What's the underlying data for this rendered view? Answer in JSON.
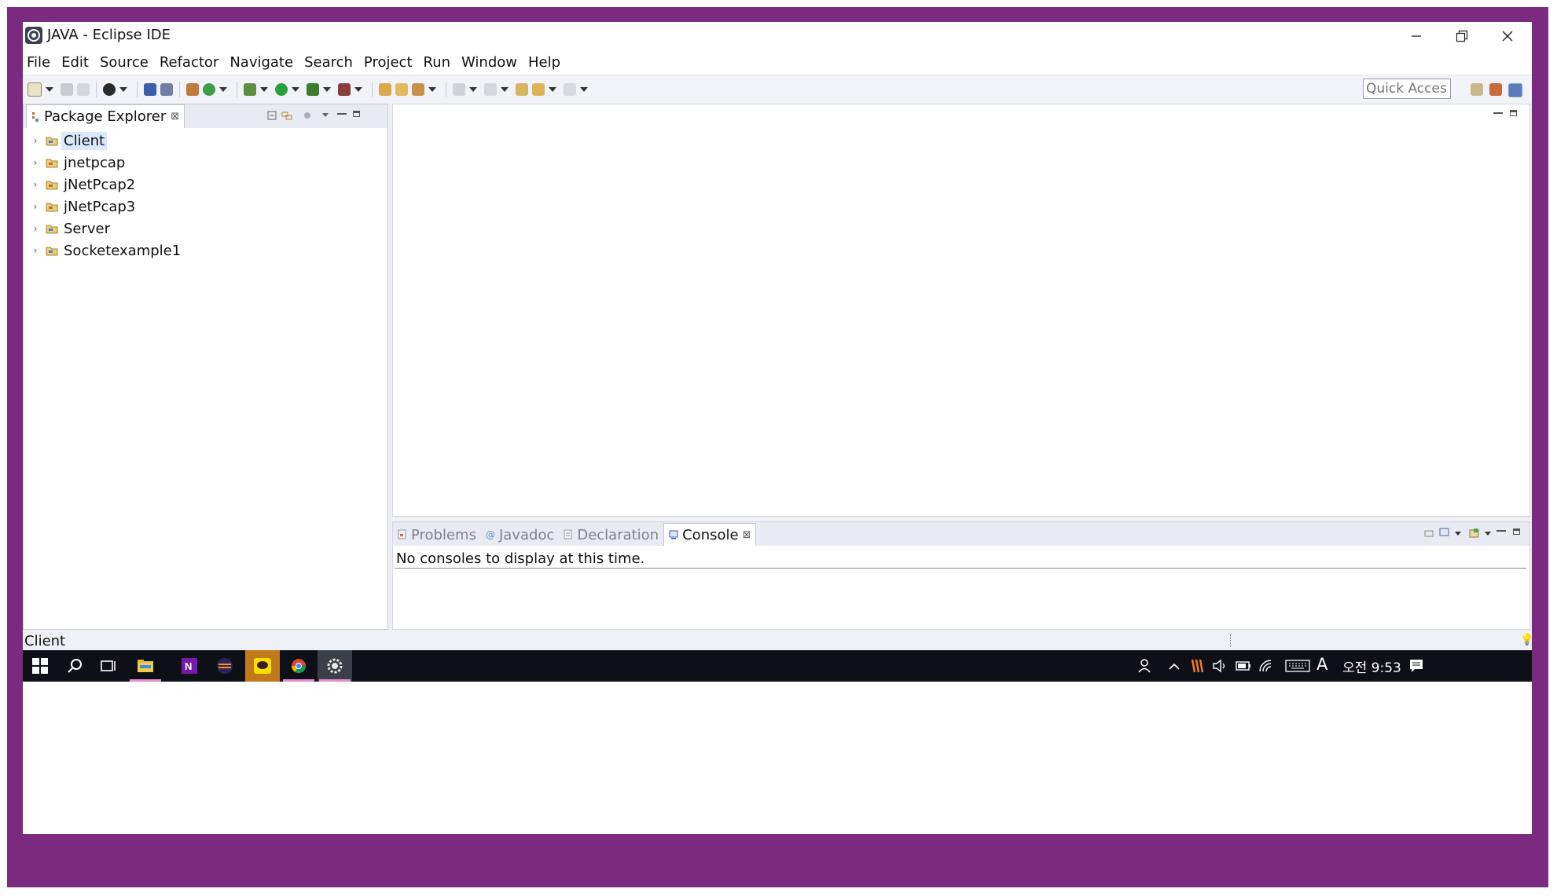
{
  "window": {
    "title": "JAVA - Eclipse IDE",
    "controls": {
      "minimize": "─",
      "restore": "❐",
      "close": "✕"
    }
  },
  "menu": [
    "File",
    "Edit",
    "Source",
    "Refactor",
    "Navigate",
    "Search",
    "Project",
    "Run",
    "Window",
    "Help"
  ],
  "toolbar": {
    "quick_access_placeholder": "Quick Access"
  },
  "package_explorer": {
    "title": "Package Explorer",
    "close": "⊠",
    "projects": [
      {
        "label": "Client",
        "selected": true
      },
      {
        "label": "jnetpcap",
        "selected": false
      },
      {
        "label": "jNetPcap2",
        "selected": false
      },
      {
        "label": "jNetPcap3",
        "selected": false
      },
      {
        "label": "Server",
        "selected": false
      },
      {
        "label": "Socketexample1",
        "selected": false
      }
    ]
  },
  "bottom_panel": {
    "tabs": [
      {
        "label": "Problems",
        "icon": "problems-icon",
        "active": false
      },
      {
        "label": "Javadoc",
        "icon": "javadoc-icon",
        "active": false
      },
      {
        "label": "Declaration",
        "icon": "declaration-icon",
        "active": false
      },
      {
        "label": "Console",
        "icon": "console-icon",
        "active": true
      }
    ],
    "tab_close": "⊠",
    "message": "No consoles to display at this time."
  },
  "status_bar": {
    "text": "Client"
  },
  "taskbar": {
    "clock": "오전 9:53",
    "ime": "A"
  },
  "colors": {
    "frame": "#7a2a7f",
    "selection": "#d9e8fb",
    "taskbar": "#0d1117",
    "taskbar_active_underline": "#e58ad4"
  }
}
